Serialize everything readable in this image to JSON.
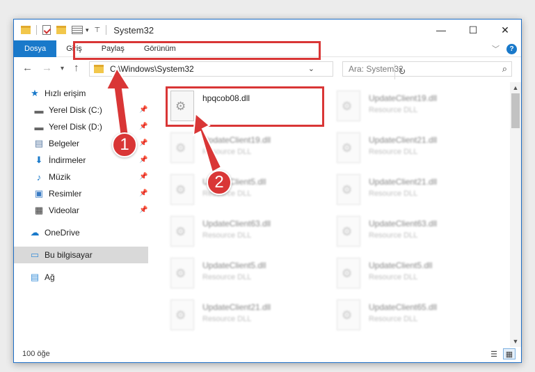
{
  "window": {
    "title": "System32",
    "minimize_glyph": "—",
    "maximize_glyph": "☐",
    "close_glyph": "✕"
  },
  "ribbon": {
    "tabs": [
      "Dosya",
      "Giriş",
      "Paylaş",
      "Görünüm"
    ],
    "active_tab": "Dosya",
    "help_glyph": "?"
  },
  "navigation": {
    "address_path": "C:\\Windows\\System32",
    "search_placeholder": "Ara: System32"
  },
  "sidebar": {
    "items": [
      {
        "label": "Hızlı erişim",
        "icon": "star-icon",
        "pinned": false
      },
      {
        "label": "Yerel Disk (C:)",
        "icon": "drive-icon",
        "pinned": true
      },
      {
        "label": "Yerel Disk (D:)",
        "icon": "drive-icon",
        "pinned": true
      },
      {
        "label": "Belgeler",
        "icon": "documents-icon",
        "pinned": true
      },
      {
        "label": "İndirmeler",
        "icon": "download-icon",
        "pinned": true
      },
      {
        "label": "Müzik",
        "icon": "music-icon",
        "pinned": true
      },
      {
        "label": "Resimler",
        "icon": "pictures-icon",
        "pinned": true
      },
      {
        "label": "Videolar",
        "icon": "videos-icon",
        "pinned": true
      },
      {
        "label": "OneDrive",
        "icon": "cloud-icon",
        "pinned": false
      },
      {
        "label": "Bu bilgisayar",
        "icon": "computer-icon",
        "pinned": false,
        "selected": true
      },
      {
        "label": "Ağ",
        "icon": "network-icon",
        "pinned": false
      }
    ]
  },
  "files": [
    {
      "name": "hpqcob08.dll",
      "type": "",
      "highlighted": true
    },
    {
      "name": "UpdateClient19.dll",
      "type": "Resource DLL"
    },
    {
      "name": "UpdateClient19.dll",
      "type": "Resource DLL"
    },
    {
      "name": "UpdateClient21.dll",
      "type": "Resource DLL"
    },
    {
      "name": "UpdateClient5.dll",
      "type": "Resource DLL"
    },
    {
      "name": "UpdateClient21.dll",
      "type": "Resource DLL"
    },
    {
      "name": "UpdateClient63.dll",
      "type": "Resource DLL"
    },
    {
      "name": "UpdateClient63.dll",
      "type": "Resource DLL"
    },
    {
      "name": "UpdateClient5.dll",
      "type": "Resource DLL"
    },
    {
      "name": "UpdateClient5.dll",
      "type": "Resource DLL"
    },
    {
      "name": "UpdateClient21.dll",
      "type": "Resource DLL"
    },
    {
      "name": "UpdateClient65.dll",
      "type": "Resource DLL"
    }
  ],
  "status": {
    "item_count": "100 öğe"
  },
  "annotations": {
    "marker_1": "1",
    "marker_2": "2",
    "highlight_color": "#d93636"
  }
}
